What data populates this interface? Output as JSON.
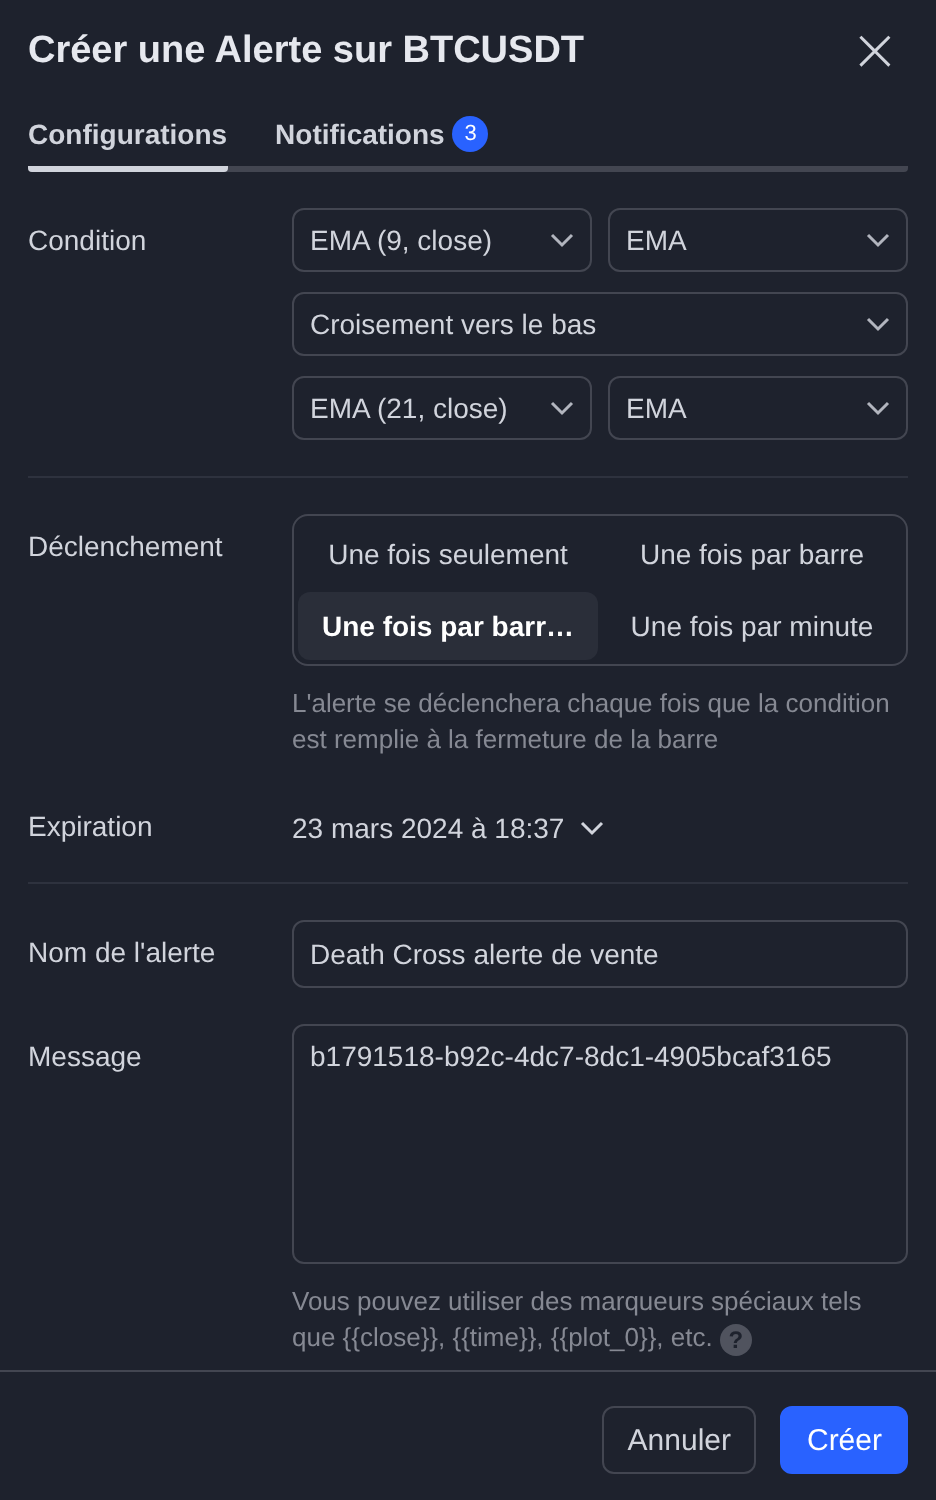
{
  "dialog": {
    "title": "Créer une Alerte sur BTCUSDT",
    "close": "×"
  },
  "tabs": [
    {
      "label": "Configurations",
      "selected": true
    },
    {
      "label": "Notifications",
      "selected": false,
      "badge": "3"
    }
  ],
  "condition": {
    "label": "Condition",
    "rows": [
      [
        "EMA (9, close)",
        "EMA"
      ],
      [
        "Croisement vers le bas"
      ],
      [
        "EMA (21, close)",
        "EMA"
      ]
    ]
  },
  "trigger": {
    "label": "Déclenchement",
    "options": [
      {
        "label": "Une fois seulement",
        "selected": false
      },
      {
        "label": "Une fois par barre",
        "selected": false
      },
      {
        "label": "Une fois par barr…",
        "selected": true
      },
      {
        "label": "Une fois par minute",
        "selected": false
      }
    ],
    "hint": "L'alerte se déclenchera chaque fois que la condition est remplie à la fermeture de la barre"
  },
  "expiration": {
    "label": "Expiration",
    "value": "23 mars 2024 à 18:37"
  },
  "alert_name": {
    "label": "Nom de l'alerte",
    "value": "Death Cross alerte de vente"
  },
  "message": {
    "label": "Message",
    "value": "b1791518-b92c-4dc7-8dc1-4905bcaf3165",
    "hint": "Vous pouvez utiliser des marqueurs spéciaux tels que {{close}}, {{time}}, {{plot_0}}, etc.",
    "help": "?"
  },
  "buttons": [
    {
      "label": "Annuler",
      "kind": "secondary"
    },
    {
      "label": "Créer",
      "kind": "primary"
    }
  ]
}
